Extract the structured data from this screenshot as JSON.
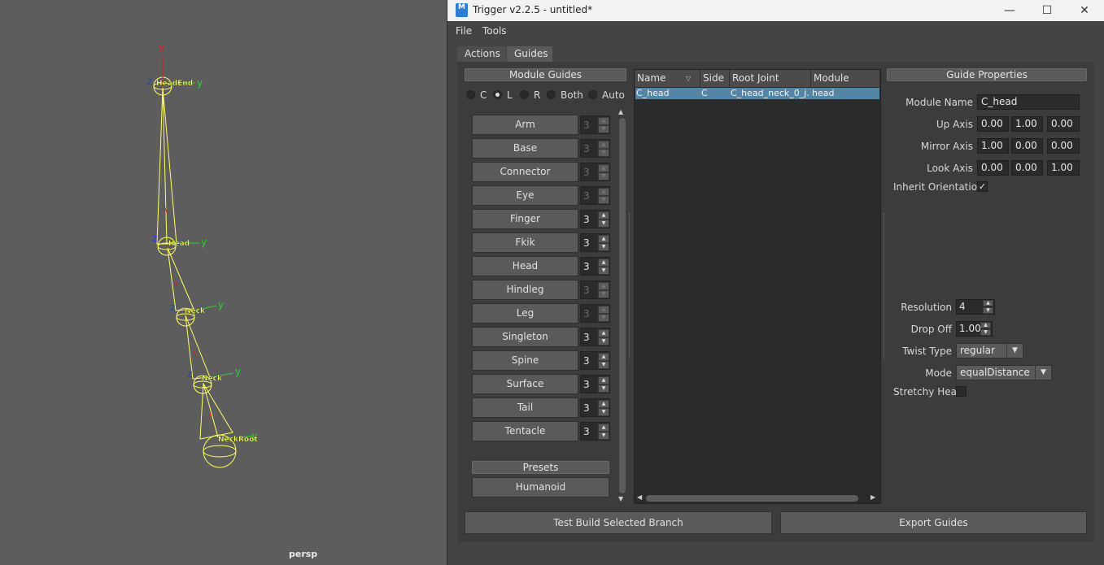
{
  "viewport": {
    "camera_label": "persp",
    "joints": [
      {
        "name": "HeadEnd"
      },
      {
        "name": "Head"
      },
      {
        "name": "Neck"
      },
      {
        "name": "Neck"
      },
      {
        "name": "NeckRoot"
      }
    ],
    "axis_labels": {
      "x": "x",
      "y": "y",
      "z": "z"
    }
  },
  "window": {
    "title": "Trigger v2.2.5 - untitled*",
    "icon_label": "M",
    "minimize": "—",
    "maximize": "☐",
    "close": "✕"
  },
  "menu": {
    "file": "File",
    "tools": "Tools"
  },
  "tabs": {
    "actions": "Actions",
    "guides": "Guides"
  },
  "module_guides": {
    "header": "Module Guides",
    "sides": [
      {
        "label": "C",
        "selected": false
      },
      {
        "label": "L",
        "selected": true
      },
      {
        "label": "R",
        "selected": false
      },
      {
        "label": "Both",
        "selected": false
      },
      {
        "label": "Auto",
        "selected": false
      }
    ],
    "items": [
      {
        "label": "Arm",
        "count": "3",
        "enabled": false
      },
      {
        "label": "Base",
        "count": "3",
        "enabled": false
      },
      {
        "label": "Connector",
        "count": "3",
        "enabled": false
      },
      {
        "label": "Eye",
        "count": "3",
        "enabled": false
      },
      {
        "label": "Finger",
        "count": "3",
        "enabled": true
      },
      {
        "label": "Fkik",
        "count": "3",
        "enabled": true
      },
      {
        "label": "Head",
        "count": "3",
        "enabled": true
      },
      {
        "label": "Hindleg",
        "count": "3",
        "enabled": false
      },
      {
        "label": "Leg",
        "count": "3",
        "enabled": false
      },
      {
        "label": "Singleton",
        "count": "3",
        "enabled": true
      },
      {
        "label": "Spine",
        "count": "3",
        "enabled": true
      },
      {
        "label": "Surface",
        "count": "3",
        "enabled": true
      },
      {
        "label": "Tail",
        "count": "3",
        "enabled": true
      },
      {
        "label": "Tentacle",
        "count": "3",
        "enabled": true
      }
    ],
    "presets_header": "Presets",
    "presets": [
      "Humanoid"
    ]
  },
  "guide_tree": {
    "columns": [
      "Name",
      "Side",
      "Root Joint",
      "Module"
    ],
    "rows": [
      {
        "name": "C_head",
        "side": "C",
        "root_joint": "C_head_neck_0_j...",
        "module": "head"
      }
    ]
  },
  "guide_properties": {
    "header": "Guide Properties",
    "module_name_label": "Module Name",
    "module_name": "C_head",
    "up_axis_label": "Up Axis",
    "up_axis": [
      "0.00",
      "1.00",
      "0.00"
    ],
    "mirror_axis_label": "Mirror Axis",
    "mirror_axis": [
      "1.00",
      "0.00",
      "0.00"
    ],
    "look_axis_label": "Look Axis",
    "look_axis": [
      "0.00",
      "0.00",
      "1.00"
    ],
    "inherit_orientation_label": "Inherit Orientation",
    "inherit_orientation": "✓",
    "resolution_label": "Resolution",
    "resolution": "4",
    "drop_off_label": "Drop Off",
    "drop_off": "1.00",
    "twist_type_label": "Twist Type",
    "twist_type": "regular",
    "mode_label": "Mode",
    "mode": "equalDistance",
    "stretchy_head_label": "Stretchy Head",
    "stretchy_head": ""
  },
  "actions": {
    "test_build": "Test Build Selected Branch",
    "export_guides": "Export Guides"
  },
  "colors": {
    "accent_selection": "#5285a6",
    "joint_yellow": "#ffff66",
    "axis_x": "#e02020",
    "axis_y": "#30d030",
    "axis_z": "#2040e0"
  }
}
